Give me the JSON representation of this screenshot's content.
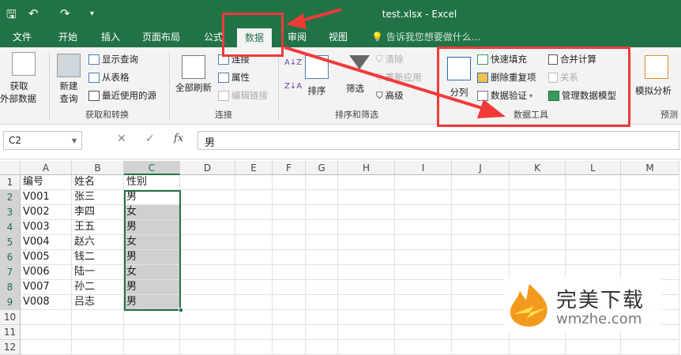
{
  "window": {
    "title": "test.xlsx - Excel"
  },
  "quick_access": {
    "save": "save-icon",
    "undo": "↶",
    "redo": "↷",
    "more": "▾"
  },
  "tabs": [
    {
      "label": "文件"
    },
    {
      "label": "开始"
    },
    {
      "label": "插入"
    },
    {
      "label": "页面布局"
    },
    {
      "label": "公式"
    },
    {
      "label": "数据",
      "active": true
    },
    {
      "label": "审阅"
    },
    {
      "label": "视图"
    }
  ],
  "tell_me": "告诉我您想要做什么...",
  "ribbon": {
    "get_external": "获取\n外部数据",
    "get_external_l1": "获取",
    "get_external_l2": "外部数据",
    "new_query_l1": "新建",
    "new_query_l2": "查询",
    "show_queries": "显示查询",
    "from_table": "从表格",
    "recent_sources": "最近使用的源",
    "group_get": "获取和转换",
    "refresh_all": "全部刷新",
    "connections": "连接",
    "properties": "属性",
    "edit_links": "编辑链接",
    "group_conn": "连接",
    "sort_az": "A↓Z",
    "sort_za": "Z↓A",
    "sort": "排序",
    "filter": "筛选",
    "clear": "清除",
    "reapply": "重新应用",
    "advanced": "高级",
    "group_sort": "排序和筛选",
    "text_to_columns": "分列",
    "flash_fill": "快速填充",
    "remove_dup": "删除重复项",
    "data_validation": "数据验证",
    "consolidate": "合并计算",
    "relationships": "关系",
    "manage_model": "管理数据模型",
    "group_tools": "数据工具",
    "what_if": "模拟分析",
    "group_forecast": "预测"
  },
  "formula_bar": {
    "name_box": "C2",
    "cancel": "✕",
    "enter": "✓",
    "fx": "fx",
    "value": "男"
  },
  "columns": [
    "A",
    "B",
    "C",
    "D",
    "E",
    "F",
    "G",
    "H",
    "I",
    "J",
    "K",
    "L",
    "M"
  ],
  "rows": [
    "1",
    "2",
    "3",
    "4",
    "5",
    "6",
    "7",
    "8",
    "9",
    "10",
    "11",
    "12"
  ],
  "cells": [
    [
      "编号",
      "姓名",
      "性别"
    ],
    [
      "V001",
      "张三",
      "男"
    ],
    [
      "V002",
      "李四",
      "女"
    ],
    [
      "V003",
      "王五",
      "男"
    ],
    [
      "V004",
      "赵六",
      "女"
    ],
    [
      "V005",
      "钱二",
      "男"
    ],
    [
      "V006",
      "陆一",
      "女"
    ],
    [
      "V007",
      "孙二",
      "男"
    ],
    [
      "V008",
      "吕志",
      "男"
    ]
  ],
  "watermark": {
    "name": "完美下载",
    "url": "wmzhe.com"
  },
  "colors": {
    "excel_green": "#217346",
    "annotation_red": "#f03a3a"
  }
}
